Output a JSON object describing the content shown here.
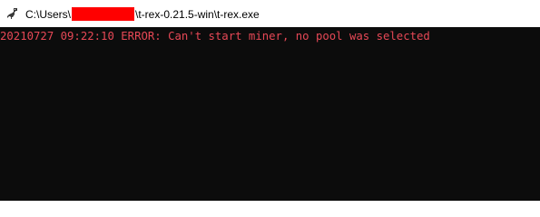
{
  "window": {
    "icon": "t-rex-dinosaur-icon",
    "title_prefix": "C:\\Users\\",
    "title_suffix": "\\t-rex-0.21.5-win\\t-rex.exe"
  },
  "console": {
    "lines": [
      "20210727 09:22:10 ERROR: Can't start miner, no pool was selected"
    ]
  },
  "colors": {
    "console_background": "#0c0c0c",
    "error_text": "#e74856",
    "redaction": "#ff0000",
    "titlebar_background": "#ffffff"
  }
}
